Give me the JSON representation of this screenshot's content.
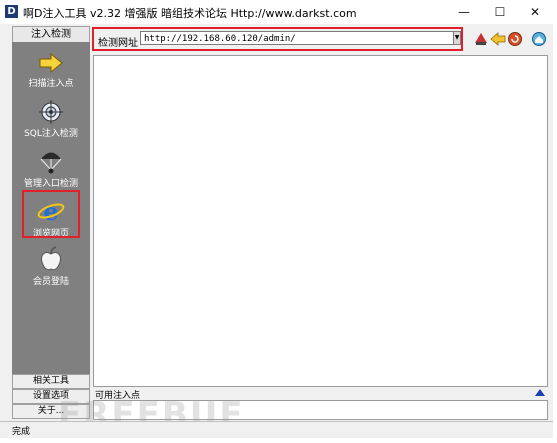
{
  "window": {
    "app_icon": "D",
    "title": "啊D注入工具 v2.32 增强版 暗组技术论坛 Http://www.darkst.com"
  },
  "title_buttons": {
    "minimize": "—",
    "maximize": "☐",
    "close": "✕"
  },
  "left_panel": {
    "header": "注入检测",
    "tools": [
      {
        "label": "扫描注入点",
        "icon": "arrow-right-icon"
      },
      {
        "label": "SQL注入检测",
        "icon": "target-icon"
      },
      {
        "label": "管理入口检测",
        "icon": "parachute-icon"
      },
      {
        "label": "浏览网页",
        "icon": "ie-browser-icon"
      },
      {
        "label": "会员登陆",
        "icon": "apple-icon"
      }
    ],
    "bottom_buttons": [
      "相关工具",
      "设置选项",
      "关于..."
    ]
  },
  "toolbar": {
    "url_label": "检测网址",
    "url_value": "http://192.168.60.120/admin/",
    "icons": [
      "stop-icon",
      "back-icon",
      "refresh-icon",
      "home-icon"
    ]
  },
  "inject_panel": {
    "label": "可用注入点"
  },
  "status": {
    "text": "完成"
  },
  "watermark": "FREEBUF",
  "colors": {
    "highlight": "#e0202a",
    "panel_bg": "#808080",
    "arrow": "#1a3fb0"
  }
}
